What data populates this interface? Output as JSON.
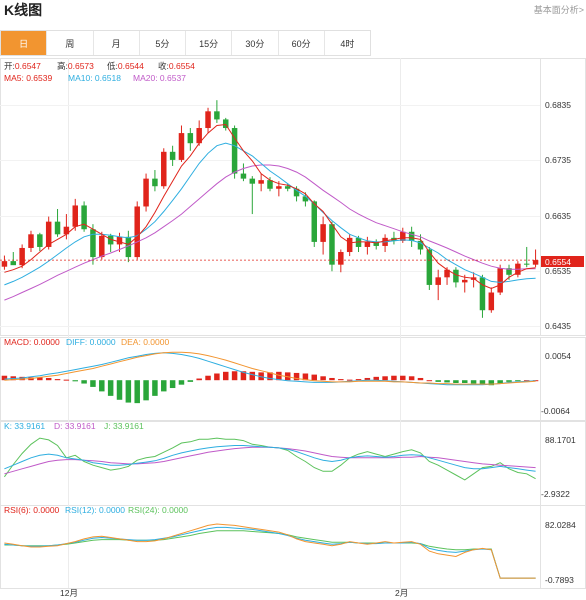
{
  "header": {
    "title": "K线图",
    "top_right": "基本面分析>"
  },
  "tabs": [
    {
      "label": "日",
      "active": true
    },
    {
      "label": "周"
    },
    {
      "label": "月"
    },
    {
      "label": "5分"
    },
    {
      "label": "15分"
    },
    {
      "label": "30分"
    },
    {
      "label": "60分"
    },
    {
      "label": "4时"
    }
  ],
  "colors": {
    "up": "#e0241b",
    "down": "#2aa63a",
    "ma5": "#e0241b",
    "ma10": "#2eaee0",
    "ma20": "#c05ac8",
    "accent": "#f29530",
    "last_price": "#e0241b"
  },
  "legend": {
    "ohlc": [
      {
        "k": "开:",
        "v": "0.6547"
      },
      {
        "k": "高:",
        "v": "0.6573"
      },
      {
        "k": "低:",
        "v": "0.6544"
      },
      {
        "k": "收:",
        "v": "0.6554"
      }
    ],
    "ma": [
      "MA5: 0.6539",
      "MA10: 0.6518",
      "MA20: 0.6537"
    ],
    "macd": [
      "MACD: 0.0000",
      "DIFF: 0.0000",
      "DEA: 0.0000"
    ],
    "kdj": [
      "K: 33.9161",
      "D: 33.9161",
      "J: 33.9161"
    ],
    "rsi": [
      "RSI(6): 0.0000",
      "RSI(12): 0.0000",
      "RSI(24): 0.0000"
    ]
  },
  "axes": {
    "price_ticks": [
      "0.6835",
      "0.6735",
      "0.6635",
      "0.6535",
      "0.6435"
    ],
    "last_price_label": "0.6554",
    "macd_ticks": [
      "0.0054",
      "-0.0064"
    ],
    "kdj_ticks": [
      "88.1701",
      "-2.9322"
    ],
    "rsi_ticks": [
      "82.0284",
      "-0.7893"
    ],
    "x_labels": [
      "12月",
      "2月"
    ]
  },
  "chart_data": {
    "type": "candlestick",
    "ylim": [
      0.641,
      0.69
    ],
    "last_price": 0.6554,
    "candles": [
      [
        0.6541,
        0.6563,
        0.6535,
        0.6552
      ],
      [
        0.6552,
        0.657,
        0.6548,
        0.6544
      ],
      [
        0.6544,
        0.6585,
        0.6538,
        0.6578
      ],
      [
        0.6578,
        0.6612,
        0.657,
        0.6605
      ],
      [
        0.6605,
        0.6608,
        0.6572,
        0.658
      ],
      [
        0.658,
        0.664,
        0.6575,
        0.663
      ],
      [
        0.663,
        0.6655,
        0.66,
        0.6605
      ],
      [
        0.6605,
        0.6645,
        0.6595,
        0.662
      ],
      [
        0.662,
        0.6675,
        0.6612,
        0.6662
      ],
      [
        0.6662,
        0.667,
        0.661,
        0.6615
      ],
      [
        0.6615,
        0.6625,
        0.6545,
        0.656
      ],
      [
        0.656,
        0.661,
        0.6555,
        0.6602
      ],
      [
        0.6602,
        0.6606,
        0.657,
        0.6585
      ],
      [
        0.6585,
        0.6608,
        0.657,
        0.66
      ],
      [
        0.66,
        0.6612,
        0.655,
        0.656
      ],
      [
        0.656,
        0.667,
        0.6555,
        0.666
      ],
      [
        0.666,
        0.6725,
        0.665,
        0.6715
      ],
      [
        0.6715,
        0.6732,
        0.669,
        0.67
      ],
      [
        0.67,
        0.6775,
        0.6695,
        0.6768
      ],
      [
        0.6768,
        0.678,
        0.674,
        0.6752
      ],
      [
        0.6752,
        0.682,
        0.6748,
        0.6805
      ],
      [
        0.6805,
        0.6815,
        0.677,
        0.6785
      ],
      [
        0.6785,
        0.683,
        0.678,
        0.6815
      ],
      [
        0.6815,
        0.6855,
        0.6805,
        0.6848
      ],
      [
        0.6848,
        0.687,
        0.6825,
        0.6832
      ],
      [
        0.6832,
        0.6835,
        0.681,
        0.6815
      ],
      [
        0.6815,
        0.682,
        0.6715,
        0.6725
      ],
      [
        0.6725,
        0.6745,
        0.671,
        0.6715
      ],
      [
        0.6715,
        0.672,
        0.6645,
        0.6705
      ],
      [
        0.6705,
        0.6725,
        0.669,
        0.6712
      ],
      [
        0.6712,
        0.6718,
        0.669,
        0.6695
      ],
      [
        0.6695,
        0.671,
        0.668,
        0.67
      ],
      [
        0.67,
        0.6705,
        0.669,
        0.6695
      ],
      [
        0.6695,
        0.67,
        0.667,
        0.668
      ],
      [
        0.668,
        0.6688,
        0.666,
        0.667
      ],
      [
        0.667,
        0.6672,
        0.658,
        0.659
      ],
      [
        0.659,
        0.664,
        0.6565,
        0.6625
      ],
      [
        0.6625,
        0.663,
        0.6532,
        0.6545
      ],
      [
        0.6545,
        0.6575,
        0.653,
        0.657
      ],
      [
        0.657,
        0.6605,
        0.6562,
        0.6598
      ],
      [
        0.6598,
        0.6602,
        0.657,
        0.658
      ],
      [
        0.658,
        0.66,
        0.6565,
        0.659
      ],
      [
        0.659,
        0.6595,
        0.6575,
        0.6582
      ],
      [
        0.6582,
        0.6605,
        0.657,
        0.6598
      ],
      [
        0.6598,
        0.661,
        0.6585,
        0.6592
      ],
      [
        0.6592,
        0.6618,
        0.6588,
        0.661
      ],
      [
        0.661,
        0.662,
        0.658,
        0.6592
      ],
      [
        0.6592,
        0.6605,
        0.6565,
        0.6575
      ],
      [
        0.6575,
        0.658,
        0.6495,
        0.6505
      ],
      [
        0.6505,
        0.6535,
        0.6475,
        0.652
      ],
      [
        0.652,
        0.654,
        0.6505,
        0.6535
      ],
      [
        0.6535,
        0.654,
        0.65,
        0.651
      ],
      [
        0.651,
        0.6525,
        0.649,
        0.6515
      ],
      [
        0.6515,
        0.653,
        0.65,
        0.652
      ],
      [
        0.652,
        0.6525,
        0.644,
        0.6455
      ],
      [
        0.6455,
        0.65,
        0.645,
        0.649
      ],
      [
        0.649,
        0.6545,
        0.6485,
        0.6538
      ],
      [
        0.6538,
        0.6545,
        0.6515,
        0.6525
      ],
      [
        0.6525,
        0.6552,
        0.652,
        0.6547
      ],
      [
        0.6547,
        0.658,
        0.654,
        0.6545
      ],
      [
        0.6545,
        0.6575,
        0.654,
        0.6554
      ]
    ],
    "ma5": [
      0.653,
      0.6535,
      0.6542,
      0.6555,
      0.657,
      0.6585,
      0.6595,
      0.6605,
      0.662,
      0.6625,
      0.6615,
      0.6605,
      0.6595,
      0.659,
      0.6585,
      0.66,
      0.662,
      0.6648,
      0.668,
      0.671,
      0.674,
      0.676,
      0.6785,
      0.6805,
      0.682,
      0.6822,
      0.6795,
      0.677,
      0.675,
      0.6725,
      0.6712,
      0.6705,
      0.6702,
      0.6695,
      0.6685,
      0.6665,
      0.665,
      0.6625,
      0.66,
      0.6588,
      0.659,
      0.659,
      0.6588,
      0.6592,
      0.6595,
      0.6598,
      0.6598,
      0.6595,
      0.657,
      0.6548,
      0.6535,
      0.6525,
      0.652,
      0.6518,
      0.6505,
      0.6498,
      0.6505,
      0.652,
      0.653,
      0.6537,
      0.6539
    ],
    "ma10": [
      0.6505,
      0.6512,
      0.652,
      0.653,
      0.654,
      0.6552,
      0.6565,
      0.6578,
      0.659,
      0.66,
      0.6605,
      0.6605,
      0.6603,
      0.66,
      0.6598,
      0.6602,
      0.6615,
      0.663,
      0.665,
      0.6672,
      0.6695,
      0.672,
      0.6745,
      0.6765,
      0.678,
      0.6785,
      0.678,
      0.677,
      0.676,
      0.6745,
      0.673,
      0.6718,
      0.6705,
      0.6692,
      0.668,
      0.6665,
      0.6648,
      0.6632,
      0.6618,
      0.6605,
      0.6598,
      0.6592,
      0.659,
      0.659,
      0.6592,
      0.6594,
      0.6593,
      0.6588,
      0.6578,
      0.6568,
      0.6555,
      0.6545,
      0.6535,
      0.6528,
      0.652,
      0.6512,
      0.651,
      0.6512,
      0.6515,
      0.6517,
      0.6518
    ],
    "ma20": [
      0.6475,
      0.6482,
      0.649,
      0.6498,
      0.6506,
      0.6515,
      0.6524,
      0.6532,
      0.654,
      0.6548,
      0.6555,
      0.6562,
      0.6568,
      0.6575,
      0.6582,
      0.659,
      0.6598,
      0.6608,
      0.662,
      0.6632,
      0.6645,
      0.666,
      0.6675,
      0.669,
      0.6705,
      0.6718,
      0.6728,
      0.6735,
      0.674,
      0.6742,
      0.6742,
      0.674,
      0.6735,
      0.6728,
      0.6718,
      0.6705,
      0.6692,
      0.668,
      0.6668,
      0.6655,
      0.6645,
      0.6636,
      0.6628,
      0.6622,
      0.6616,
      0.661,
      0.6605,
      0.66,
      0.6592,
      0.6585,
      0.6578,
      0.657,
      0.6562,
      0.6555,
      0.6548,
      0.6542,
      0.6538,
      0.6536,
      0.6536,
      0.6537,
      0.6537
    ],
    "macd_hist": [
      0.0008,
      0.0007,
      0.0006,
      0.0005,
      0.0005,
      0.0004,
      0.0002,
      0.0001,
      -0.0002,
      -0.0006,
      -0.0012,
      -0.002,
      -0.0028,
      -0.0035,
      -0.004,
      -0.0041,
      -0.0036,
      -0.0028,
      -0.002,
      -0.0014,
      -0.0008,
      -0.0003,
      0.0003,
      0.0008,
      0.0012,
      0.0015,
      0.0016,
      0.0016,
      0.0015,
      0.0014,
      0.0014,
      0.0015,
      0.0014,
      0.0013,
      0.0012,
      0.001,
      0.0007,
      0.0004,
      0.0002,
      0.0001,
      0.0002,
      0.0004,
      0.0006,
      0.0007,
      0.0008,
      0.0008,
      0.0007,
      0.0004,
      0.0,
      -0.0003,
      -0.0004,
      -0.0005,
      -0.0005,
      -0.0006,
      -0.0008,
      -0.0009,
      -0.0006,
      -0.0003,
      -0.0001,
      0.0,
      0.0
    ],
    "diff": [
      0.0002,
      0.0003,
      0.0004,
      0.0006,
      0.0008,
      0.0011,
      0.0013,
      0.0016,
      0.0019,
      0.0022,
      0.0025,
      0.0028,
      0.0032,
      0.0036,
      0.004,
      0.0043,
      0.0046,
      0.0048,
      0.0049,
      0.0048,
      0.0046,
      0.0043,
      0.0039,
      0.0034,
      0.0029,
      0.0024,
      0.0019,
      0.0014,
      0.001,
      0.0006,
      0.0003,
      0.0001,
      -0.0001,
      -0.0002,
      -0.0003,
      -0.0004,
      -0.0004,
      -0.0004,
      -0.0003,
      -0.0002,
      -0.0001,
      0.0,
      0.0,
      -0.0001,
      -0.0002,
      -0.0003,
      -0.0004,
      -0.0005,
      -0.0006,
      -0.0007,
      -0.0008,
      -0.0008,
      -0.0008,
      -0.0008,
      -0.0008,
      -0.0007,
      -0.0006,
      -0.0004,
      -0.0003,
      -0.0002,
      -0.0001
    ],
    "dea": [
      0.0,
      0.0001,
      0.0002,
      0.0003,
      0.0005,
      0.0007,
      0.0009,
      0.0012,
      0.0015,
      0.0018,
      0.0021,
      0.0025,
      0.0029,
      0.0033,
      0.0037,
      0.0041,
      0.0044,
      0.0047,
      0.0049,
      0.005,
      0.005,
      0.0049,
      0.0047,
      0.0044,
      0.004,
      0.0036,
      0.0031,
      0.0026,
      0.0021,
      0.0017,
      0.0013,
      0.0009,
      0.0006,
      0.0003,
      0.0001,
      -0.0001,
      -0.0002,
      -0.0003,
      -0.0003,
      -0.0003,
      -0.0002,
      -0.0002,
      -0.0002,
      -0.0002,
      -0.0003,
      -0.0003,
      -0.0004,
      -0.0005,
      -0.0005,
      -0.0006,
      -0.0006,
      -0.0007,
      -0.0007,
      -0.0007,
      -0.0007,
      -0.0007,
      -0.0006,
      -0.0005,
      -0.0004,
      -0.0003,
      -0.0002
    ],
    "kdj_k": [
      38,
      44,
      50,
      56,
      60,
      62,
      60,
      56,
      54,
      52,
      48,
      46,
      44,
      44,
      45,
      47,
      49,
      51,
      55,
      60,
      64,
      67,
      70,
      72,
      74,
      75,
      76,
      76,
      75,
      74,
      73,
      72,
      70,
      66,
      61,
      56,
      52,
      50,
      52,
      56,
      58,
      59,
      58,
      57,
      58,
      60,
      61,
      60,
      56,
      52,
      48,
      44,
      40,
      38,
      38,
      40,
      42,
      40,
      38,
      36,
      34
    ],
    "kdj_d": [
      30,
      34,
      38,
      42,
      46,
      50,
      52,
      53,
      53,
      52,
      51,
      50,
      48,
      47,
      46,
      46,
      47,
      48,
      50,
      53,
      56,
      59,
      62,
      65,
      67,
      69,
      71,
      72,
      73,
      73,
      73,
      72,
      71,
      69,
      67,
      64,
      61,
      58,
      57,
      56,
      56,
      56,
      56,
      56,
      56,
      57,
      57,
      58,
      57,
      56,
      54,
      52,
      50,
      48,
      46,
      45,
      44,
      43,
      42,
      41,
      40
    ],
    "kdj_j": [
      25,
      45,
      63,
      78,
      88,
      85,
      76,
      56,
      60,
      50,
      44,
      40,
      36,
      38,
      42,
      52,
      56,
      58,
      65,
      72,
      80,
      82,
      86,
      86,
      88,
      86,
      86,
      84,
      78,
      76,
      73,
      72,
      68,
      58,
      50,
      40,
      34,
      34,
      44,
      56,
      62,
      66,
      62,
      58,
      62,
      66,
      69,
      64,
      50,
      44,
      36,
      28,
      20,
      30,
      40,
      42,
      48,
      38,
      32,
      30,
      22
    ],
    "rsi6": [
      54,
      52,
      50,
      48,
      48,
      49,
      50,
      53,
      56,
      60,
      63,
      64,
      62,
      60,
      58,
      56,
      56,
      57,
      60,
      64,
      68,
      72,
      76,
      80,
      82,
      81,
      80,
      78,
      76,
      74,
      72,
      70,
      66,
      60,
      56,
      54,
      52,
      50,
      52,
      56,
      54,
      52,
      54,
      56,
      54,
      55,
      56,
      52,
      42,
      38,
      36,
      34,
      40,
      44,
      46,
      44,
      2,
      2,
      2,
      2,
      2
    ],
    "rsi12": [
      52,
      51,
      50,
      49,
      49,
      50,
      51,
      53,
      55,
      58,
      61,
      62,
      61,
      60,
      59,
      58,
      58,
      59,
      61,
      63,
      66,
      69,
      72,
      75,
      77,
      77,
      76,
      75,
      74,
      72,
      70,
      68,
      65,
      61,
      58,
      56,
      54,
      52,
      53,
      55,
      54,
      53,
      53,
      54,
      54,
      54,
      55,
      53,
      46,
      43,
      41,
      40,
      42,
      44,
      45,
      44,
      2,
      2,
      2,
      2,
      2
    ],
    "rsi24": [
      51,
      51,
      50,
      50,
      50,
      50,
      51,
      52,
      54,
      56,
      58,
      59,
      59,
      59,
      58,
      58,
      58,
      58,
      59,
      61,
      63,
      65,
      68,
      70,
      72,
      72,
      72,
      72,
      71,
      70,
      69,
      68,
      66,
      63,
      61,
      59,
      57,
      55,
      55,
      55,
      54,
      54,
      54,
      54,
      54,
      54,
      54,
      53,
      49,
      47,
      45,
      44,
      44,
      45,
      45,
      45,
      2,
      2,
      2,
      2,
      2
    ]
  }
}
